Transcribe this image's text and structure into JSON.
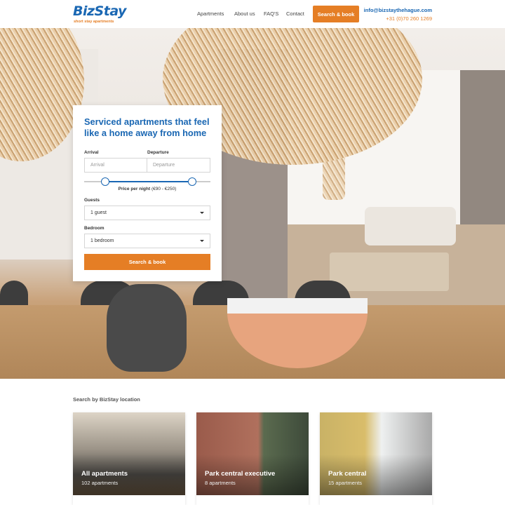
{
  "header": {
    "logo_text": "BizStay",
    "logo_tagline": "short stay apartments",
    "nav": [
      "Apartments",
      "About us",
      "FAQ'S",
      "Contact"
    ],
    "cta_label": "Search & book",
    "email": "info@bizstaythehague.com",
    "phone": "+31 (0)70 260 1269"
  },
  "search_card": {
    "title": "Serviced apartments that feel like a home away from home",
    "arrival_label": "Arrival",
    "arrival_placeholder": "Arrival",
    "departure_label": "Departure",
    "departure_placeholder": "Departure",
    "price_label": "Price per night",
    "price_range": "(€90 - €250)",
    "guests_label": "Guests",
    "guests_value": "1 guest",
    "bedroom_label": "Bedroom",
    "bedroom_value": "1 bedroom",
    "submit_label": "Search & book"
  },
  "locations": {
    "section_title": "Search by BizStay location",
    "items": [
      {
        "name": "All apartments",
        "count": "102 apartments"
      },
      {
        "name": "Park central executive",
        "count": "8 apartments"
      },
      {
        "name": "Park central",
        "count": "15 apartments"
      }
    ]
  },
  "colors": {
    "brand_blue": "#1a67b3",
    "accent_orange": "#e57e25"
  }
}
